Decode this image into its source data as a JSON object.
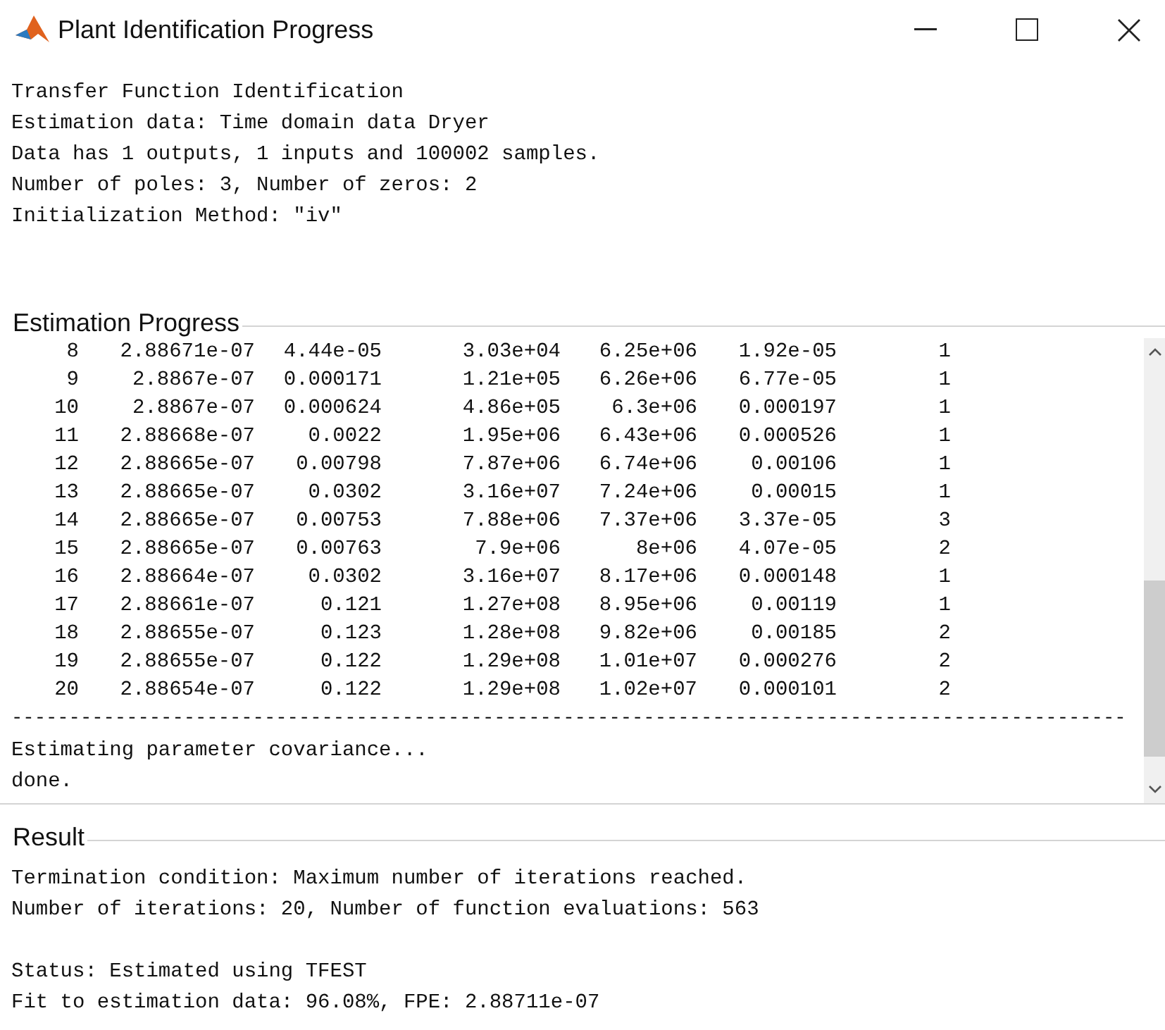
{
  "window": {
    "title": "Plant Identification Progress"
  },
  "info_lines": [
    "Transfer Function Identification",
    "Estimation data: Time domain data Dryer",
    "Data has 1 outputs, 1 inputs and 100002 samples.",
    "Number of poles: 3, Number of zeros: 2",
    "Initialization Method: \"iv\""
  ],
  "estimation_progress": {
    "title": "Estimation Progress",
    "rows": [
      [
        "8",
        "2.88671e-07",
        "4.44e-05",
        "3.03e+04",
        "6.25e+06",
        "1.92e-05",
        "1"
      ],
      [
        "9",
        "2.8867e-07",
        "0.000171",
        "1.21e+05",
        "6.26e+06",
        "6.77e-05",
        "1"
      ],
      [
        "10",
        "2.8867e-07",
        "0.000624",
        "4.86e+05",
        "6.3e+06",
        "0.000197",
        "1"
      ],
      [
        "11",
        "2.88668e-07",
        "0.0022",
        "1.95e+06",
        "6.43e+06",
        "0.000526",
        "1"
      ],
      [
        "12",
        "2.88665e-07",
        "0.00798",
        "7.87e+06",
        "6.74e+06",
        "0.00106",
        "1"
      ],
      [
        "13",
        "2.88665e-07",
        "0.0302",
        "3.16e+07",
        "7.24e+06",
        "0.00015",
        "1"
      ],
      [
        "14",
        "2.88665e-07",
        "0.00753",
        "7.88e+06",
        "7.37e+06",
        "3.37e-05",
        "3"
      ],
      [
        "15",
        "2.88665e-07",
        "0.00763",
        "7.9e+06",
        "8e+06",
        "4.07e-05",
        "2"
      ],
      [
        "16",
        "2.88664e-07",
        "0.0302",
        "3.16e+07",
        "8.17e+06",
        "0.000148",
        "1"
      ],
      [
        "17",
        "2.88661e-07",
        "0.121",
        "1.27e+08",
        "8.95e+06",
        "0.00119",
        "1"
      ],
      [
        "18",
        "2.88655e-07",
        "0.123",
        "1.28e+08",
        "9.82e+06",
        "0.00185",
        "2"
      ],
      [
        "19",
        "2.88655e-07",
        "0.122",
        "1.29e+08",
        "1.01e+07",
        "0.000276",
        "2"
      ],
      [
        "20",
        "2.88654e-07",
        "0.122",
        "1.29e+08",
        "1.02e+07",
        "0.000101",
        "2"
      ]
    ],
    "separator": "-------------------------------------------------------------------------------------------------",
    "after_lines": [
      "Estimating parameter covariance...",
      "done."
    ]
  },
  "result": {
    "title": "Result",
    "paragraphs": [
      [
        "Termination condition: Maximum number of iterations reached.",
        "Number of iterations: 20, Number of function evaluations: 563"
      ],
      [
        "Status: Estimated using TFEST",
        "Fit to estimation data: 96.08%, FPE: 2.88711e-07"
      ]
    ]
  }
}
